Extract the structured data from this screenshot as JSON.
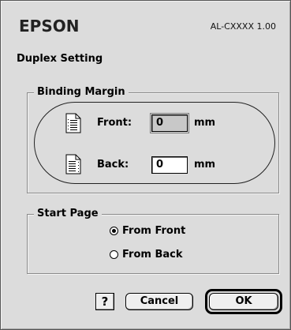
{
  "header": {
    "brand": "EPSON",
    "model": "AL-CXXXX 1.00"
  },
  "dialog": {
    "title": "Duplex Setting"
  },
  "binding_margin": {
    "label": "Binding Margin",
    "front": {
      "label": "Front:",
      "value": "0",
      "unit": "mm",
      "icon": "page-binding-left-icon"
    },
    "back": {
      "label": "Back:",
      "value": "0",
      "unit": "mm",
      "icon": "page-binding-right-icon"
    }
  },
  "start_page": {
    "label": "Start Page",
    "options": [
      {
        "label": "From Front",
        "selected": true
      },
      {
        "label": "From Back",
        "selected": false
      }
    ]
  },
  "buttons": {
    "help": "?",
    "cancel": "Cancel",
    "ok": "OK"
  }
}
